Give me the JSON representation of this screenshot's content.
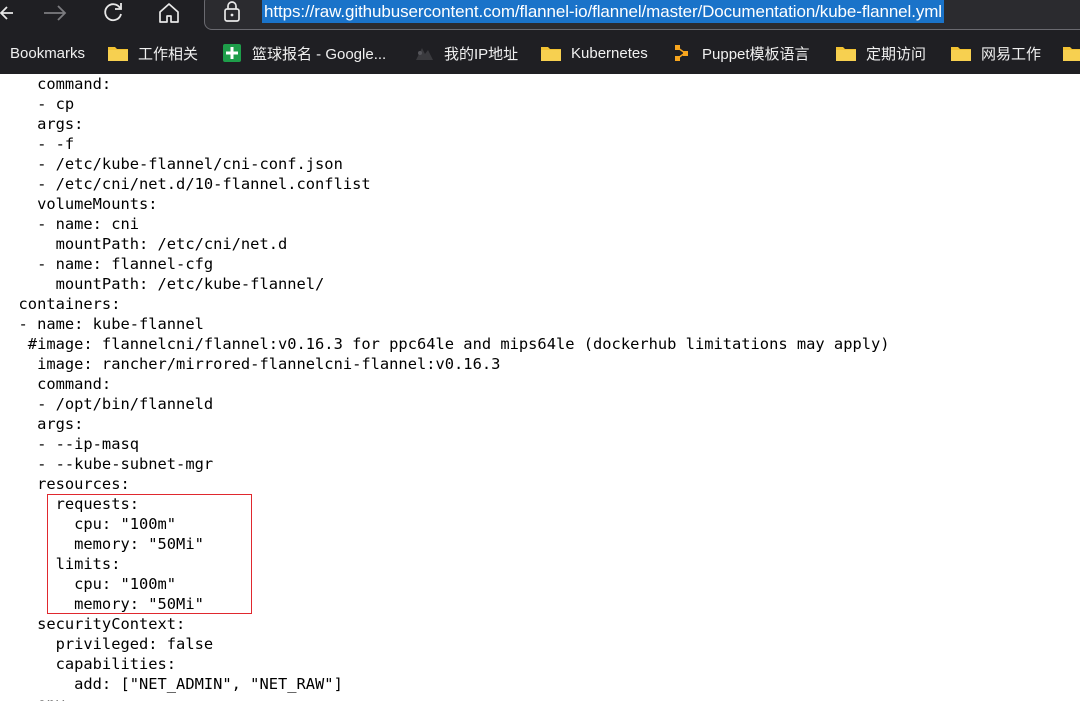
{
  "browser": {
    "nav": {
      "back_icon": "arrow-left-icon",
      "forward_icon": "arrow-right-icon",
      "refresh_icon": "refresh-icon",
      "home_icon": "home-icon"
    },
    "address_bar": {
      "security_icon": "lock-icon",
      "url": "https://raw.githubusercontent.com/flannel-io/flannel/master/Documentation/kube-flannel.yml",
      "selection_color": "#1a73c9"
    }
  },
  "bookmarks": [
    {
      "label": "Bookmarks",
      "icon": ""
    },
    {
      "label": "工作相关",
      "icon": "folder-icon"
    },
    {
      "label": "篮球报名 - Google...",
      "icon": "google-sheets-icon"
    },
    {
      "label": "我的IP地址",
      "icon": "ip-site-icon"
    },
    {
      "label": "Kubernetes",
      "icon": "folder-icon"
    },
    {
      "label": "Puppet模板语言",
      "icon": "puppet-icon"
    },
    {
      "label": "定期访问",
      "icon": "folder-icon"
    },
    {
      "label": "网易工作",
      "icon": "folder-icon"
    }
  ],
  "document": {
    "lines": [
      "    command:",
      "    - cp",
      "    args:",
      "    - -f",
      "    - /etc/kube-flannel/cni-conf.json",
      "    - /etc/cni/net.d/10-flannel.conflist",
      "    volumeMounts:",
      "    - name: cni",
      "      mountPath: /etc/cni/net.d",
      "    - name: flannel-cfg",
      "      mountPath: /etc/kube-flannel/",
      "  containers:",
      "  - name: kube-flannel",
      "   #image: flannelcni/flannel:v0.16.3 for ppc64le and mips64le (dockerhub limitations may apply)",
      "    image: rancher/mirrored-flannelcni-flannel:v0.16.3",
      "    command:",
      "    - /opt/bin/flanneld",
      "    args:",
      "    - --ip-masq",
      "    - --kube-subnet-mgr",
      "    resources:",
      "      requests:",
      "        cpu: \"100m\"",
      "        memory: \"50Mi\"",
      "      limits:",
      "        cpu: \"100m\"",
      "        memory: \"50Mi\"",
      "    securityContext:",
      "      privileged: false",
      "      capabilities:",
      "        add: [\"NET_ADMIN\", \"NET_RAW\"]",
      "    env:"
    ],
    "annotation_color": "#e0282e"
  }
}
